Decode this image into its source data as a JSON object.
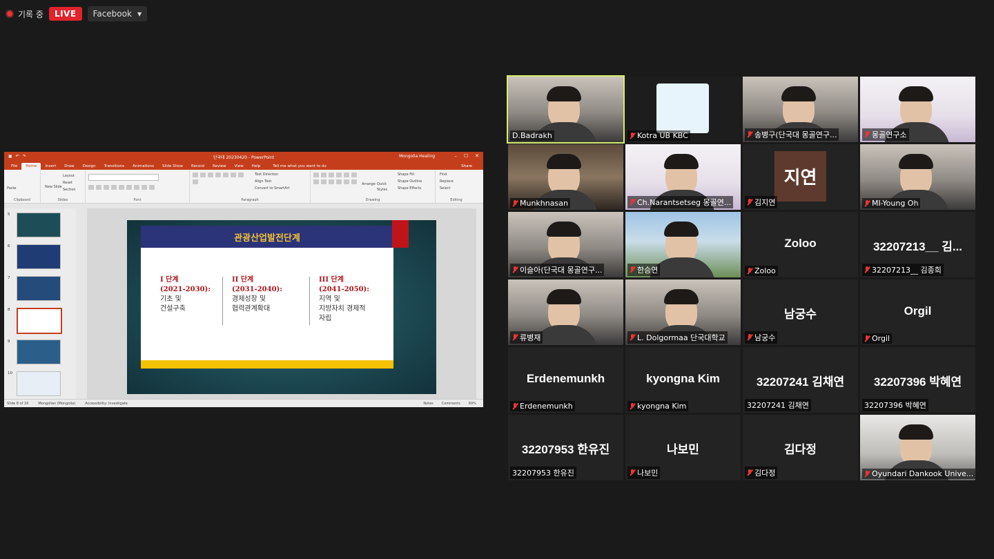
{
  "topbar": {
    "recording": "기록 중",
    "live": "LIVE",
    "stream_target": "Facebook"
  },
  "ppt": {
    "window_title": "단국대 20230420 - PowerPoint",
    "account": "Mongolia Healing",
    "tabs": [
      "File",
      "Home",
      "Insert",
      "Draw",
      "Design",
      "Transitions",
      "Animations",
      "Slide Show",
      "Record",
      "Review",
      "View",
      "Help"
    ],
    "tell_me": "Tell me what you want to do",
    "share": "Share",
    "groups": [
      "Clipboard",
      "Slides",
      "Font",
      "Paragraph",
      "Drawing",
      "Editing"
    ],
    "ribbon": {
      "paste": "Paste",
      "new_slide": "New Slide",
      "layout": "Layout",
      "reset": "Reset",
      "section": "Section",
      "text_direction": "Text Direction",
      "align_text": "Align Text",
      "convert": "Convert to SmartArt",
      "arrange": "Arrange",
      "quick_styles": "Quick Styles",
      "shape_fill": "Shape Fill",
      "shape_outline": "Shape Outline",
      "shape_effects": "Shape Effects",
      "find": "Find",
      "replace": "Replace",
      "select": "Select"
    },
    "thumb_numbers": [
      "5",
      "6",
      "7",
      "8",
      "9",
      "10"
    ],
    "slide": {
      "title": "관광산업발전단계",
      "col1": {
        "h": "I 단계",
        "y": "(2021-2030):",
        "t1": "기초 및",
        "t2": "건설구축"
      },
      "col2": {
        "h": "II 단계",
        "y": "(2031-2040):",
        "t1": "경제성장 및",
        "t2": "협력관계확대"
      },
      "col3": {
        "h": "III 단계",
        "y": "(2041-2050):",
        "t1": "지역 및",
        "t2": "지방자치 경제적",
        "t3": "자립"
      }
    },
    "status": {
      "slide": "Slide 8 of 16",
      "lang": "Mongolian (Mongolia)",
      "access": "Accessibility: Investigate",
      "notes": "Notes",
      "comments": "Comments",
      "zoom": "69%"
    }
  },
  "participants": [
    {
      "name": "D.Badrakh",
      "muted": false,
      "active": true,
      "video": "person"
    },
    {
      "name": "Kotra UB KBC",
      "muted": true,
      "video": "logo"
    },
    {
      "name": "송병구(단국대 몽골연구...",
      "muted": true,
      "video": "person"
    },
    {
      "name": "몽골연구소",
      "muted": true,
      "video": "poster"
    },
    {
      "name": "Munkhnasan",
      "muted": true,
      "video": "shelf"
    },
    {
      "name": "Ch.Narantsetseg 몽골연...",
      "muted": true,
      "video": "poster"
    },
    {
      "name": "김지연",
      "muted": true,
      "video": "avatar",
      "avatar_text": "지연"
    },
    {
      "name": "MI-Young Oh",
      "muted": true,
      "video": "person"
    },
    {
      "name": "이슬아(단국대 몽골연구...",
      "muted": true,
      "video": "person"
    },
    {
      "name": "한승연",
      "muted": true,
      "video": "ger"
    },
    {
      "name": "Zoloo",
      "muted": true,
      "big": "Zoloo"
    },
    {
      "name": "32207213__ 김종희",
      "muted": true,
      "big": "32207213__ 김..."
    },
    {
      "name": "류병재",
      "muted": true,
      "video": "person"
    },
    {
      "name": "L. Dolgormaa 단국대학교",
      "muted": true,
      "video": "person"
    },
    {
      "name": "남궁수",
      "muted": true,
      "big": "남궁수"
    },
    {
      "name": "Orgil",
      "muted": true,
      "big": "Orgil"
    },
    {
      "name": "Erdenemunkh",
      "muted": true,
      "big": "Erdenemunkh"
    },
    {
      "name": "kyongna Kim",
      "muted": true,
      "big": "kyongna Kim"
    },
    {
      "name": "32207241 김채연",
      "muted": false,
      "big": "32207241 김채연"
    },
    {
      "name": "32207396 박혜연",
      "muted": false,
      "big": "32207396 박혜연"
    },
    {
      "name": "32207953 한유진",
      "muted": false,
      "big": "32207953 한유진"
    },
    {
      "name": "나보민",
      "muted": true,
      "big": "나보민"
    },
    {
      "name": "김다정",
      "muted": true,
      "big": "김다정"
    },
    {
      "name": "Oyundari Dankook Unive...",
      "muted": true,
      "video": "room"
    }
  ]
}
